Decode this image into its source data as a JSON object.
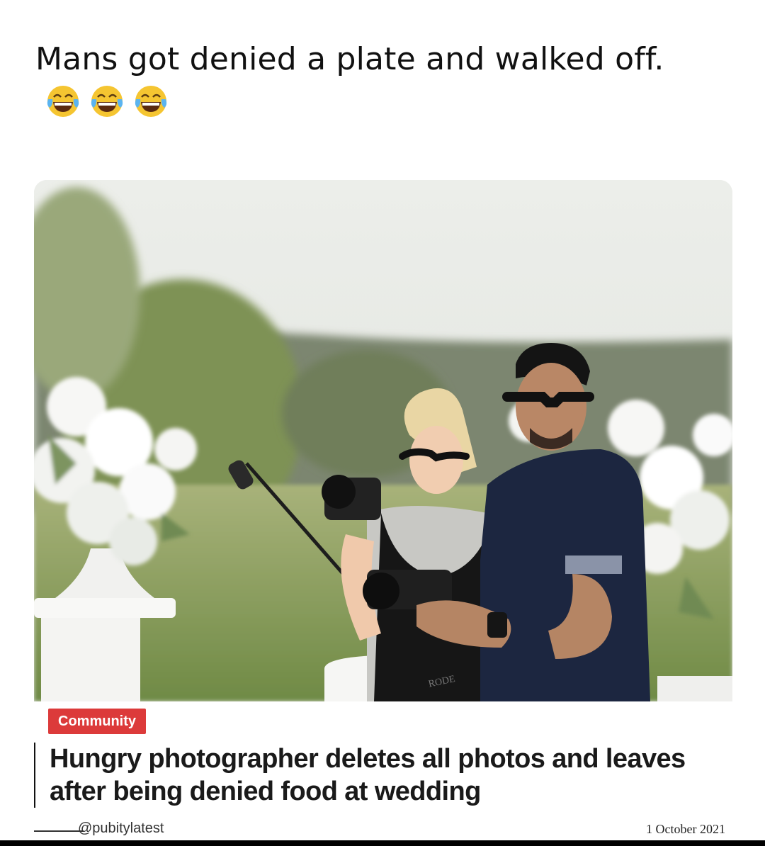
{
  "post": {
    "caption": "Mans got denied a plate and walked off.",
    "emojis": [
      "face-with-tears-of-joy-icon",
      "face-with-tears-of-joy-icon",
      "face-with-tears-of-joy-icon"
    ]
  },
  "article": {
    "category": "Community",
    "headline": "Hungry photographer deletes all photos and leaves after being denied food at wedding",
    "source": "@pubitylatest",
    "date": "1 October 2021",
    "photo_text": "RODE"
  },
  "colors": {
    "badge": "#dc3a3a",
    "text": "#1a1a1a",
    "emoji_face": "#f5c531"
  }
}
